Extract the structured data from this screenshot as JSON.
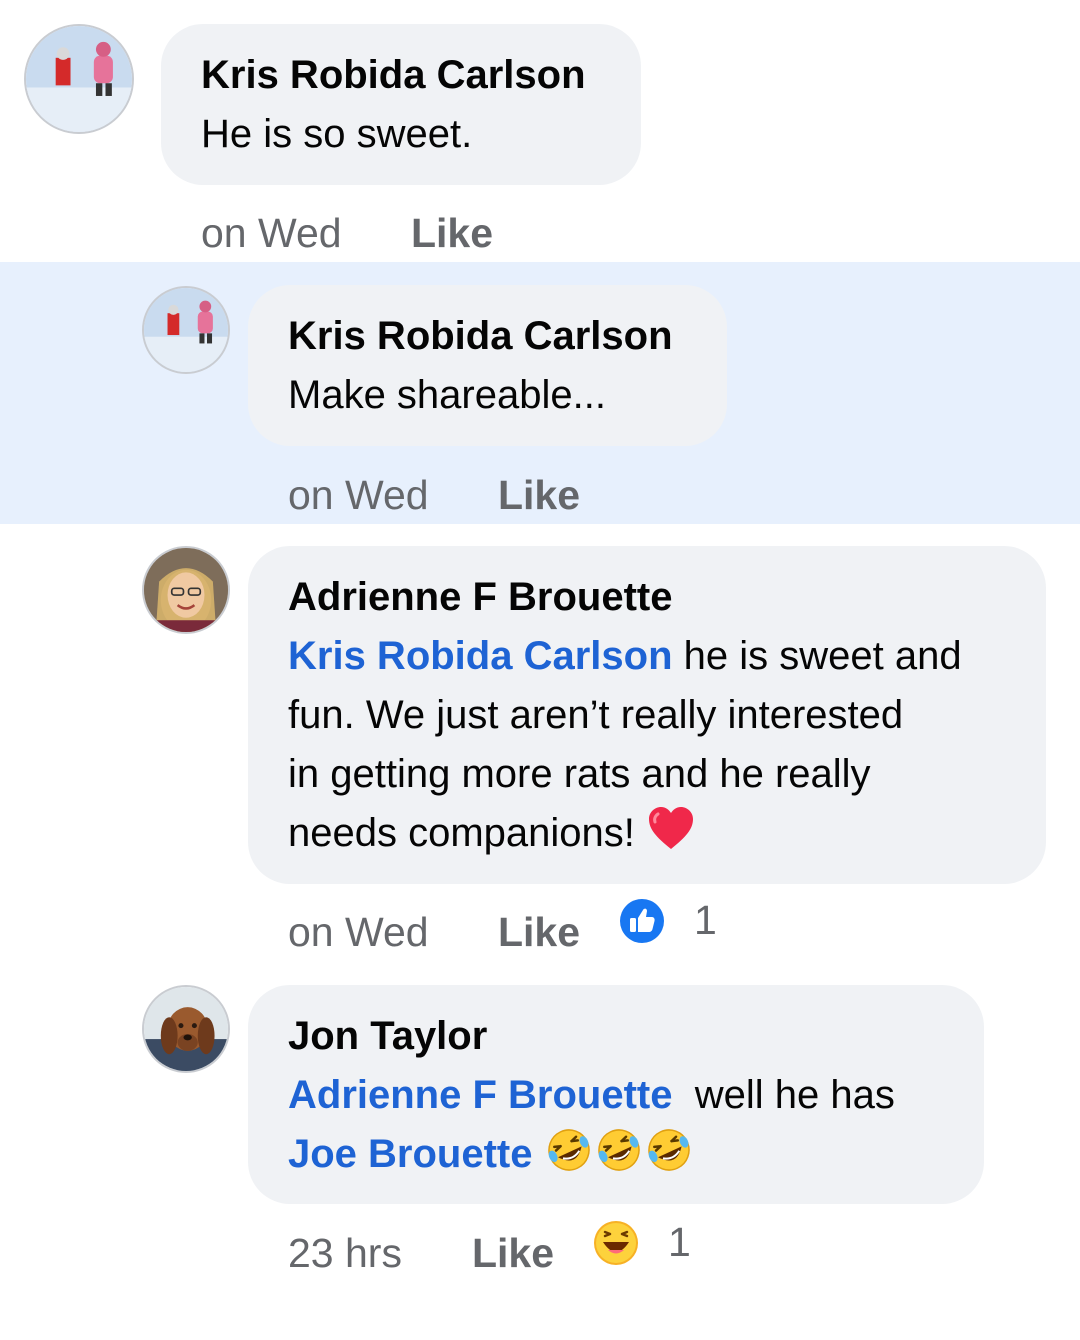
{
  "comments": [
    {
      "author": "Kris Robida Carlson",
      "text": "He is so sweet.",
      "time": "on Wed",
      "like_label": "Like"
    },
    {
      "author": "Kris Robida Carlson",
      "text": "Make shareable...",
      "time": "on Wed",
      "like_label": "Like",
      "highlighted": true
    },
    {
      "author": "Adrienne F Brouette",
      "mention": "Kris Robida Carlson",
      "text_line1": " he is sweet and",
      "text_line2": "fun. We just aren’t really interested",
      "text_line3": "in getting more rats and he really",
      "text_line4": "needs companions! ",
      "emoji": "red-heart",
      "time": "on Wed",
      "like_label": "Like",
      "reaction": "like-reaction",
      "reaction_count": "1"
    },
    {
      "author": "Jon Taylor",
      "mention": "Adrienne F Brouette",
      "text_line1": "  well he has",
      "mention2": "Joe Brouette",
      "emoji": "rolling-on-floor-laughing x3",
      "time": "23 hrs",
      "like_label": "Like",
      "reaction": "haha-reaction",
      "reaction_count": "1"
    }
  ],
  "colors": {
    "highlight_band": "#e7f0fd",
    "bubble": "#f0f2f5",
    "mention": "#1e63d4",
    "meta": "#65676b",
    "like_blue": "#1877f2"
  }
}
